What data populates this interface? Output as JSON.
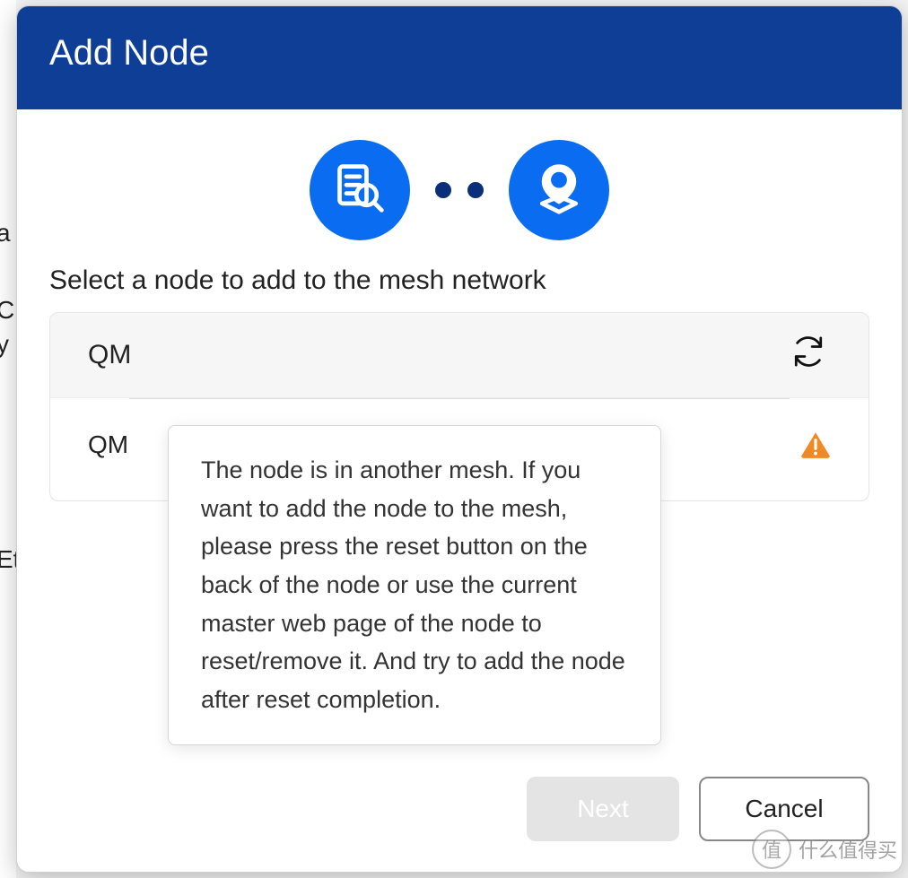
{
  "background": {
    "fragments": {
      "a": "a",
      "c": "C",
      "y": "y",
      "et": "Et"
    }
  },
  "modal": {
    "title": "Add Node",
    "section_heading": "Select a node to add to the mesh network",
    "steps": {
      "step1_icon": "search-document-icon",
      "step2_icon": "location-pin-icon"
    },
    "card": {
      "header_label": "QM",
      "row_label": "QM"
    },
    "tooltip": "The node is in another mesh. If you want to add the node to the mesh, please press the reset button on the back of the node or use the current master web page of the node to reset/remove it. And try to add the node after reset completion.",
    "footer": {
      "next_label": "Next",
      "cancel_label": "Cancel"
    }
  },
  "watermark": {
    "mark": "值",
    "text": "什么值得买"
  },
  "colors": {
    "header_bg": "#0f3e96",
    "accent": "#0a6cf1",
    "dot": "#0b2e7a",
    "warning": "#f08a24"
  }
}
